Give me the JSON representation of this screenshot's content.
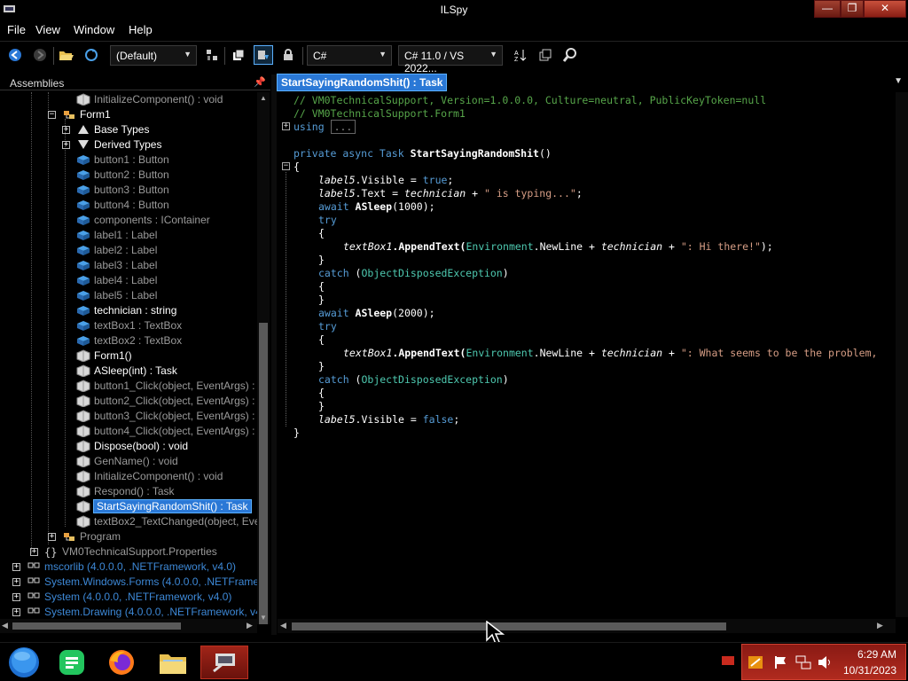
{
  "window": {
    "title": "ILSpy"
  },
  "menu": [
    "File",
    "View",
    "Window",
    "Help"
  ],
  "toolbar": {
    "language_filter": "(Default)",
    "language": "C#",
    "version": "C# 11.0 / VS 2022..."
  },
  "assemblies_panel": {
    "header": "Assemblies"
  },
  "tree": [
    {
      "label": "InitializeComponent() : void",
      "style": "grey"
    },
    {
      "label": "Form1",
      "style": "white"
    },
    {
      "label": "Base Types",
      "style": "white"
    },
    {
      "label": "Derived Types",
      "style": "white"
    },
    {
      "label": "button1 : Button",
      "style": "grey"
    },
    {
      "label": "button2 : Button",
      "style": "grey"
    },
    {
      "label": "button3 : Button",
      "style": "grey"
    },
    {
      "label": "button4 : Button",
      "style": "grey"
    },
    {
      "label": "components : IContainer",
      "style": "grey"
    },
    {
      "label": "label1 : Label",
      "style": "grey"
    },
    {
      "label": "label2 : Label",
      "style": "grey"
    },
    {
      "label": "label3 : Label",
      "style": "grey"
    },
    {
      "label": "label4 : Label",
      "style": "grey"
    },
    {
      "label": "label5 : Label",
      "style": "grey"
    },
    {
      "label": "technician : string",
      "style": "white"
    },
    {
      "label": "textBox1 : TextBox",
      "style": "grey"
    },
    {
      "label": "textBox2 : TextBox",
      "style": "grey"
    },
    {
      "label": "Form1()",
      "style": "white"
    },
    {
      "label": "ASleep(int) : Task",
      "style": "white"
    },
    {
      "label": "button1_Click(object, EventArgs) :",
      "style": "grey"
    },
    {
      "label": "button2_Click(object, EventArgs) :",
      "style": "grey"
    },
    {
      "label": "button3_Click(object, EventArgs) :",
      "style": "grey"
    },
    {
      "label": "button4_Click(object, EventArgs) :",
      "style": "grey"
    },
    {
      "label": "Dispose(bool) : void",
      "style": "white"
    },
    {
      "label": "GenName() : void",
      "style": "grey"
    },
    {
      "label": "InitializeComponent() : void",
      "style": "grey"
    },
    {
      "label": "Respond() : Task",
      "style": "grey"
    },
    {
      "label": "StartSayingRandomShit() : Task",
      "style": "selected"
    },
    {
      "label": "textBox2_TextChanged(object, Ever",
      "style": "grey"
    },
    {
      "label": "Program",
      "style": "grey"
    },
    {
      "label": "VM0TechnicalSupport.Properties",
      "style": "grey"
    },
    {
      "label": "mscorlib (4.0.0.0, .NETFramework, v4.0)",
      "style": "link"
    },
    {
      "label": "System.Windows.Forms (4.0.0.0, .NETFramew",
      "style": "link"
    },
    {
      "label": "System (4.0.0.0, .NETFramework, v4.0)",
      "style": "link"
    },
    {
      "label": "System.Drawing (4.0.0.0, .NETFramework, v4.0",
      "style": "link"
    }
  ],
  "tab": {
    "title": "StartSayingRandomShit() : Task"
  },
  "code": {
    "l1": "// VM0TechnicalSupport, Version=1.0.0.0, Culture=neutral, PublicKeyToken=null",
    "l2": "// VM0TechnicalSupport.Form1",
    "l3_kw": "using",
    "l3_fold": "...",
    "l4_a": "private async Task ",
    "l4_b": "StartSayingRandomShit",
    "l4_c": "()",
    "l5": "{",
    "l6_a": "label5",
    "l6_b": ".Visible = ",
    "l6_c": "true",
    "l6_d": ";",
    "l7_a": "label5",
    "l7_b": ".Text = ",
    "l7_c": "technician",
    "l7_d": " + ",
    "l7_e": "\" is typing...\"",
    "l7_f": ";",
    "l8_a": "await ",
    "l8_b": "ASleep",
    "l8_c": "(1000);",
    "try": "try",
    "open": "{",
    "close": "}",
    "tb1": "textBox1",
    "append": ".AppendText(",
    "env": "Environment",
    "newline": ".NewLine + ",
    "tech": "technician",
    "plus": " + ",
    "s1": "\": Hi there!\"",
    "s1_end": ");",
    "catch_kw": "catch",
    "catch_open": " (",
    "ode": "ObjectDisposedException",
    "catch_close": ")",
    "l16_c": "(2000);",
    "s2": "\": What seems to be the problem,",
    "l_last_a": "label5",
    "l_last_b": ".Visible = ",
    "l_last_c": "false",
    "l_last_d": ";"
  },
  "taskbar": {
    "clock_time": "6:29 AM",
    "clock_date": "10/31/2023"
  }
}
